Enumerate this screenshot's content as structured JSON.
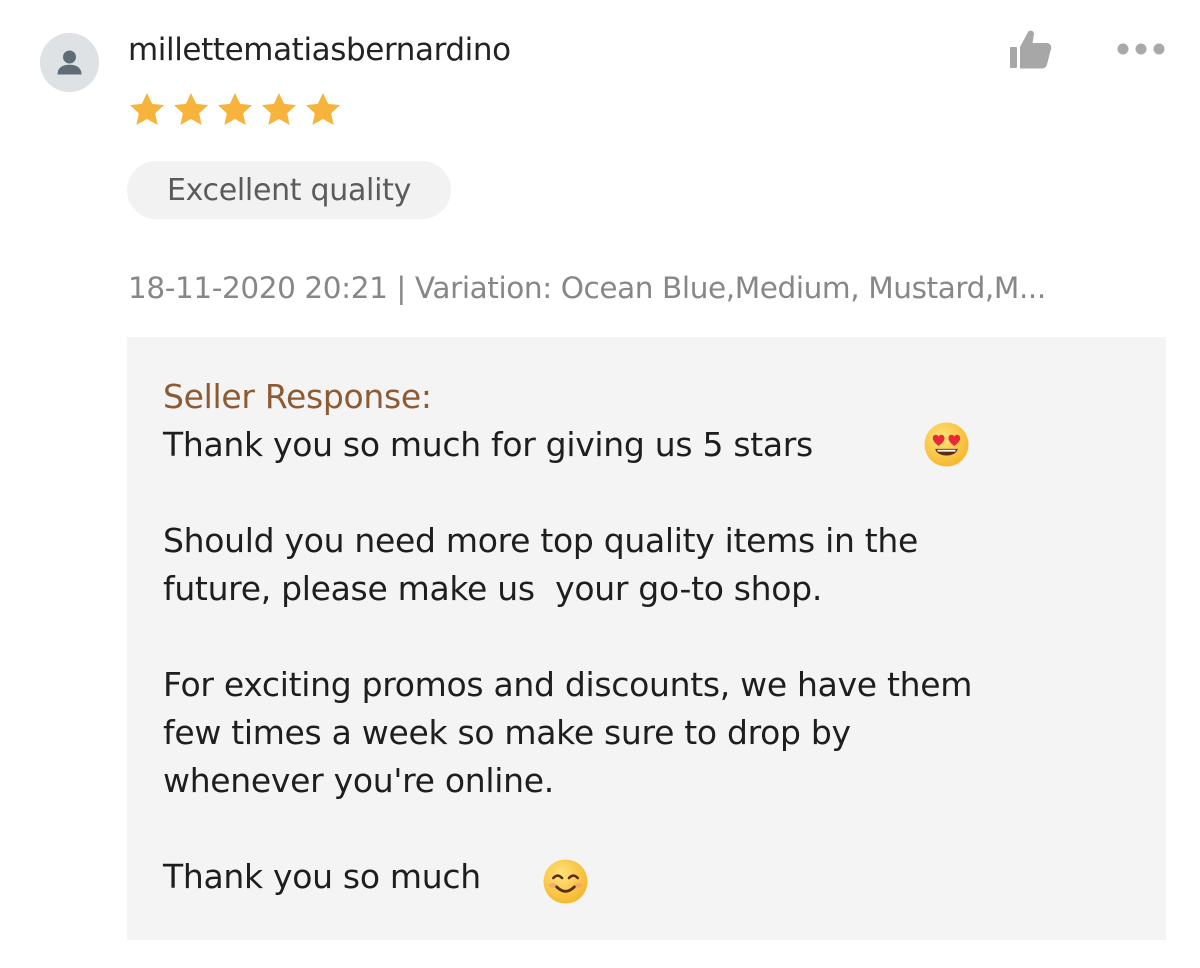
{
  "review": {
    "username": "millettematiasbernardino",
    "rating": 5,
    "rating_max": 5,
    "tag": "Excellent quality",
    "meta": "18-11-2020 20:21 | Variation: Ocean Blue,Medium, Mustard,M...",
    "star_color": "#f6b43c"
  },
  "icons": {
    "avatar": "person-silhouette",
    "like": "thumbs-up-icon",
    "more": "ellipsis-icon"
  },
  "seller_response": {
    "title": "Seller Response:",
    "lines": [
      "Thank you so much for giving us 5 stars",
      "Should you need more top quality items in the",
      "future, please make us  your go-to shop.",
      "For exciting promos and discounts, we have them",
      "few times a week so make sure to drop by",
      "whenever you're online.",
      "Thank you so much"
    ],
    "emojis": [
      "smiling-face-with-heart-eyes",
      "smiling-face-with-smiling-eyes"
    ]
  }
}
